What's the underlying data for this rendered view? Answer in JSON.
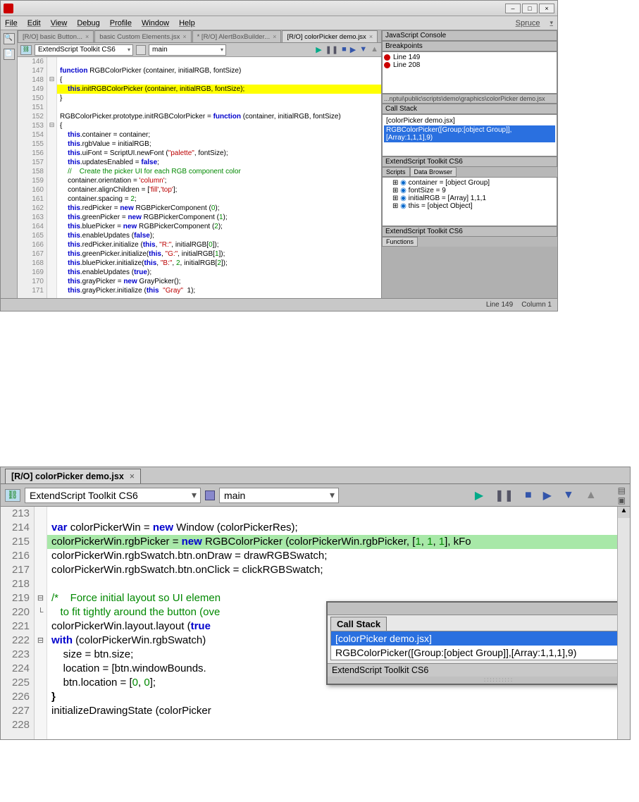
{
  "top": {
    "menus": [
      "File",
      "Edit",
      "View",
      "Debug",
      "Profile",
      "Window",
      "Help"
    ],
    "theme": "Spruce",
    "tabs": [
      {
        "label": "[R/O] basic Button...",
        "active": false
      },
      {
        "label": "basic Custom Elements.jsx",
        "active": false
      },
      {
        "label": "* [R/O] AlertBoxBuilder...",
        "active": false
      },
      {
        "label": "[R/O] colorPicker demo.jsx",
        "active": true
      }
    ],
    "target_app": "ExtendScript Toolkit CS6",
    "target_engine": "main",
    "debug_icons": [
      "▶",
      "❚❚",
      "■",
      "▶",
      "▼",
      "▲"
    ],
    "code_start_line": 146,
    "code_lines": [
      {
        "n": 146,
        "fold": "",
        "html": ""
      },
      {
        "n": 147,
        "fold": "",
        "html": "<span class='kw'>function</span> RGBColorPicker (container, initialRGB, fontSize)"
      },
      {
        "n": 148,
        "fold": "⊟",
        "html": "{"
      },
      {
        "n": 149,
        "fold": "",
        "bp": true,
        "hl": true,
        "html": "    <span class='kw'>this</span>.initRGBColorPicker (container, initialRGB, fontSize);"
      },
      {
        "n": 150,
        "fold": "",
        "html": "}"
      },
      {
        "n": 151,
        "fold": "",
        "html": ""
      },
      {
        "n": 152,
        "fold": "",
        "html": "RGBColorPicker.prototype.initRGBColorPicker = <span class='fn'>function</span> (container, initialRGB, fontSize)"
      },
      {
        "n": 153,
        "fold": "⊟",
        "html": "{"
      },
      {
        "n": 154,
        "fold": "",
        "html": "    <span class='kw'>this</span>.container = container;"
      },
      {
        "n": 155,
        "fold": "",
        "html": "    <span class='kw'>this</span>.rgbValue = initialRGB;"
      },
      {
        "n": 156,
        "fold": "",
        "html": "    <span class='kw'>this</span>.uiFont = ScriptUI.newFont (<span class='str'>\"palette\"</span>, fontSize);"
      },
      {
        "n": 157,
        "fold": "",
        "html": "    <span class='kw'>this</span>.updatesEnabled = <span class='kw'>false</span>;"
      },
      {
        "n": 158,
        "fold": "",
        "html": "    <span class='cm'>//    Create the picker UI for each RGB component color</span>"
      },
      {
        "n": 159,
        "fold": "",
        "html": "    container.orientation = <span class='str'>'column'</span>;"
      },
      {
        "n": 160,
        "fold": "",
        "html": "    container.alignChildren = [<span class='str'>'fill'</span>,<span class='str'>'top'</span>];"
      },
      {
        "n": 161,
        "fold": "",
        "html": "    container.spacing = <span class='num'>2</span>;"
      },
      {
        "n": 162,
        "fold": "",
        "html": "    <span class='kw'>this</span>.redPicker = <span class='kw'>new</span> RGBPickerComponent (<span class='num'>0</span>);"
      },
      {
        "n": 163,
        "fold": "",
        "html": "    <span class='kw'>this</span>.greenPicker = <span class='kw'>new</span> RGBPickerComponent (<span class='num'>1</span>);"
      },
      {
        "n": 164,
        "fold": "",
        "html": "    <span class='kw'>this</span>.bluePicker = <span class='kw'>new</span> RGBPickerComponent (<span class='num'>2</span>);"
      },
      {
        "n": 165,
        "fold": "",
        "html": "    <span class='kw'>this</span>.enableUpdates (<span class='kw'>false</span>);"
      },
      {
        "n": 166,
        "fold": "",
        "html": "    <span class='kw'>this</span>.redPicker.initialize (<span class='kw'>this</span>, <span class='str'>\"R:\"</span>, initialRGB[<span class='num'>0</span>]);"
      },
      {
        "n": 167,
        "fold": "",
        "html": "    <span class='kw'>this</span>.greenPicker.initialize(<span class='kw'>this</span>, <span class='str'>\"G:\"</span>, initialRGB[<span class='num'>1</span>]);"
      },
      {
        "n": 168,
        "fold": "",
        "html": "    <span class='kw'>this</span>.bluePicker.initialize(<span class='kw'>this</span>, <span class='str'>\"B:\"</span>, <span class='num'>2</span>, initialRGB[<span class='num'>2</span>]);"
      },
      {
        "n": 169,
        "fold": "",
        "html": "    <span class='kw'>this</span>.enableUpdates (<span class='kw'>true</span>);"
      },
      {
        "n": 170,
        "fold": "",
        "html": "    <span class='kw'>this</span>.grayPicker = <span class='kw'>new</span> GrayPicker();"
      },
      {
        "n": 171,
        "fold": "",
        "html": "    <span class='kw'>this</span>.grayPicker.initialize (<span class='kw'>this</span>  <span class='str'>\"Gray\"</span>  1);"
      }
    ],
    "panels": {
      "js_console": "JavaScript Console",
      "breakpoints_title": "Breakpoints",
      "breakpoints": [
        "Line 149",
        "Line 208"
      ],
      "path": "...nptui\\public\\scripts\\demo\\graphics\\colorPicker demo.jsx",
      "callstack_title": "Call Stack",
      "callstack": [
        {
          "label": "[colorPicker demo.jsx]",
          "sel": false
        },
        {
          "label": "RGBColorPicker([Group:[object Group]],[Array:1,1,1],9)",
          "sel": true
        }
      ],
      "estk_title": "ExtendScript Toolkit CS6",
      "scripts_tab": "Scripts",
      "data_browser_tab": "Data Browser",
      "vars": [
        "container = [object Group]",
        "fontSize = 9",
        "initialRGB = [Array] 1,1,1",
        "this = [object Object]"
      ],
      "functions_title": "Functions"
    },
    "status": {
      "line": "Line 149",
      "col": "Column 1"
    }
  },
  "bottom": {
    "tab_label": "[R/O] colorPicker demo.jsx",
    "target_app": "ExtendScript Toolkit CS6",
    "target_engine": "main",
    "debug_icons": [
      "▶",
      "❚❚",
      "■",
      "▶",
      "▼",
      "▲"
    ],
    "code_lines": [
      {
        "n": 213,
        "fold": "",
        "html": ""
      },
      {
        "n": 214,
        "fold": "",
        "html": "<span class='kw'>var</span> colorPickerWin = <span class='kw'>new</span> Window (colorPickerRes);"
      },
      {
        "n": 215,
        "fold": "",
        "hl": true,
        "html": "colorPickerWin.rgbPicker = <span class='kw'>new</span> RGBColorPicker (colorPickerWin.rgbPicker, [<span class='num'>1</span>, <span class='num'>1</span>, <span class='num'>1</span>], kFo"
      },
      {
        "n": 216,
        "fold": "",
        "html": "colorPickerWin.rgbSwatch.btn.onDraw = drawRGBSwatch;"
      },
      {
        "n": 217,
        "fold": "",
        "html": "colorPickerWin.rgbSwatch.btn.onClick = clickRGBSwatch;"
      },
      {
        "n": 218,
        "fold": "",
        "html": ""
      },
      {
        "n": 219,
        "fold": "⊟",
        "html": "<span class='cm'>/*    Force initial layout so UI elemen</span>"
      },
      {
        "n": 220,
        "fold": "└",
        "html": "<span class='cm'>   to fit tightly around the button (ove</span>"
      },
      {
        "n": 221,
        "fold": "",
        "html": "colorPickerWin.layout.layout (<span class='kw'>true</span>"
      },
      {
        "n": 222,
        "fold": "⊟",
        "html": "<span class='kw'>with</span> (colorPickerWin.rgbSwatch) "
      },
      {
        "n": 223,
        "fold": "",
        "html": "    size = btn.size;"
      },
      {
        "n": 224,
        "fold": "",
        "html": "    location = [btn.windowBounds."
      },
      {
        "n": 225,
        "fold": "",
        "html": "    btn.location = [<span class='num'>0</span>, <span class='num'>0</span>];"
      },
      {
        "n": 226,
        "fold": "",
        "html": "<b>}</b>"
      },
      {
        "n": 227,
        "fold": "",
        "html": "initializeDrawingState (colorPicker"
      },
      {
        "n": 228,
        "fold": "",
        "html": ""
      }
    ],
    "callstack_title": "Call Stack",
    "callstack": [
      {
        "label": "[colorPicker demo.jsx]",
        "sel": true
      },
      {
        "label": "RGBColorPicker([Group:[object Group]],[Array:1,1,1],9)",
        "sel": false
      }
    ],
    "callstack_footer": "ExtendScript Toolkit CS6"
  }
}
